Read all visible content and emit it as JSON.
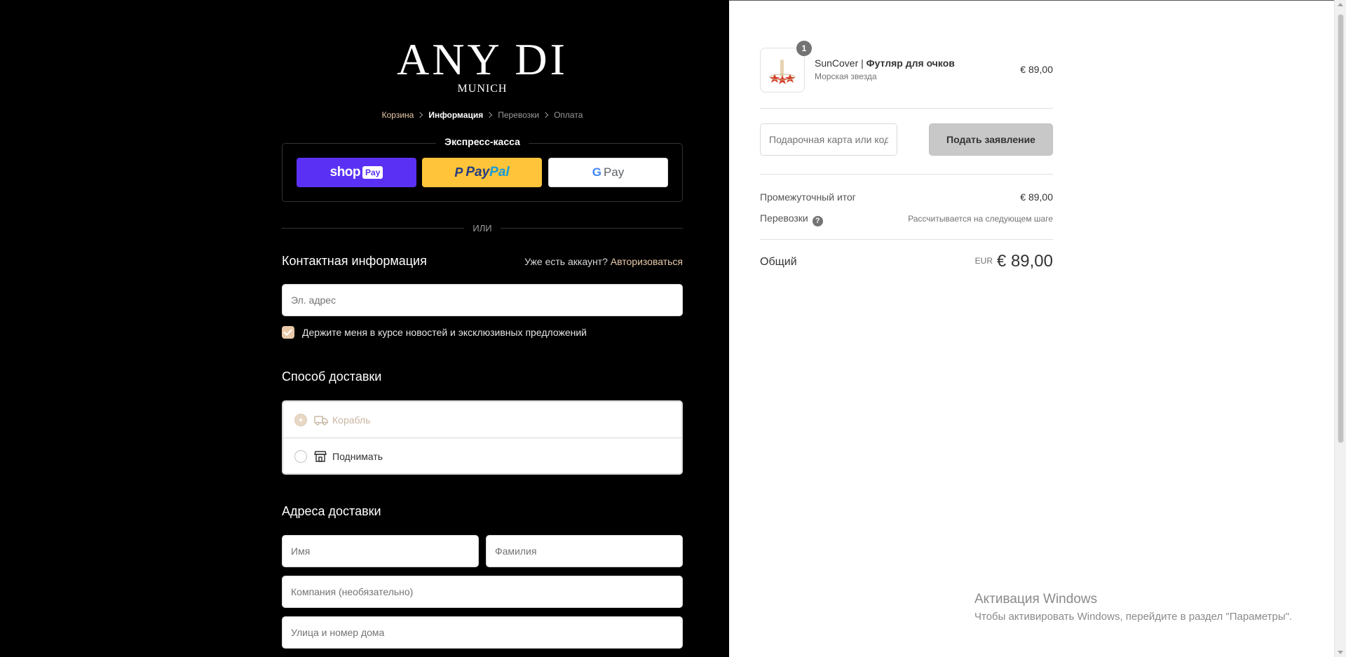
{
  "brand": {
    "name": "ANY DI",
    "city": "MUNICH"
  },
  "breadcrumb": {
    "cart": "Корзина",
    "info": "Информация",
    "shipping": "Перевозки",
    "payment": "Оплата"
  },
  "express": {
    "title": "Экспресс-касса",
    "shop_pay": "shop",
    "shop_pay_badge": "Pay",
    "paypal_1": "Pay",
    "paypal_2": "Pal",
    "gpay_g": "G",
    "gpay_label": "Pay"
  },
  "or_text": "ИЛИ",
  "contact": {
    "title": "Контактная информация",
    "account_question": "Уже есть аккаунт?",
    "login_link": "Авторизоваться",
    "email_placeholder": "Эл. адрес",
    "newsletter_label": "Держите меня в курсе новостей и эксклюзивных предложений"
  },
  "delivery": {
    "title": "Способ доставки",
    "option_ship": "Корабль",
    "option_pickup": "Поднимать"
  },
  "address": {
    "title": "Адреса доставки",
    "first_name": "Имя",
    "last_name": "Фамилия",
    "company": "Компания (необязательно)",
    "street": "Улица и номер дома"
  },
  "summary": {
    "quantity": "1",
    "product_brand": "SunCover |",
    "product_title": " Футляр для очков",
    "product_variant": "Морская звезда",
    "product_price": "€ 89,00",
    "gift_placeholder": "Подарочная карта или код скидки",
    "apply_button": "Подать заявление",
    "subtotal_label": "Промежуточный итог",
    "subtotal_value": "€ 89,00",
    "shipping_label": "Перевозки",
    "shipping_help": "?",
    "shipping_value": "Рассчитывается на следующем шаге",
    "total_label": "Общий",
    "currency": "EUR",
    "total_value": "€ 89,00"
  },
  "watermark": {
    "title": "Активация Windows",
    "text": "Чтобы активировать Windows, перейдите в раздел \"Параметры\"."
  },
  "colors": {
    "accent": "#e8c9a9",
    "shop_pay": "#5a31f4",
    "paypal": "#ffc439"
  }
}
